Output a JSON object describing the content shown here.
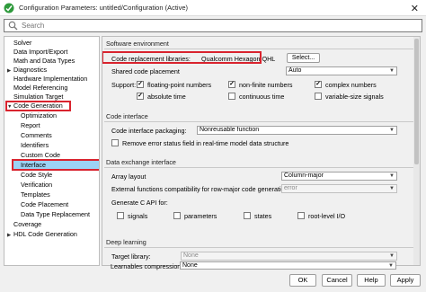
{
  "window": {
    "title": "Configuration Parameters: untitled/Configuration (Active)",
    "close_glyph": "✕"
  },
  "search": {
    "placeholder": "Search"
  },
  "tree": {
    "items": [
      {
        "label": "Solver"
      },
      {
        "label": "Data Import/Export"
      },
      {
        "label": "Math and Data Types"
      },
      {
        "label": "Diagnostics",
        "arrow": "▶"
      },
      {
        "label": "Hardware Implementation"
      },
      {
        "label": "Model Referencing"
      },
      {
        "label": "Simulation Target"
      },
      {
        "label": "Code Generation",
        "arrow": "▼"
      },
      {
        "label": "Optimization"
      },
      {
        "label": "Report"
      },
      {
        "label": "Comments"
      },
      {
        "label": "Identifiers"
      },
      {
        "label": "Custom Code"
      },
      {
        "label": "Interface"
      },
      {
        "label": "Code Style"
      },
      {
        "label": "Verification"
      },
      {
        "label": "Templates"
      },
      {
        "label": "Code Placement"
      },
      {
        "label": "Data Type Replacement"
      },
      {
        "label": "Coverage"
      },
      {
        "label": "HDL Code Generation",
        "arrow": "▶"
      }
    ]
  },
  "software_env": {
    "title": "Software environment",
    "ccr_label": "Code replacement libraries:",
    "ccr_value": "Qualcomm Hexagon QHL",
    "select_button": "Select...",
    "shared_label": "Shared code placement",
    "shared_value": "Auto",
    "support_label": "Support:",
    "options": {
      "floating": "floating-point numbers",
      "nonfinite": "non-finite numbers",
      "complex": "complex numbers",
      "absolute": "absolute time",
      "continuous": "continuous time",
      "variable": "variable-size signals"
    }
  },
  "code_interface": {
    "title": "Code interface",
    "packaging_label": "Code interface packaging:",
    "packaging_value": "Nonreusable function",
    "remove_error_label": "Remove error status field in real-time model data structure"
  },
  "data_exchange": {
    "title": "Data exchange interface",
    "array_label": "Array layout",
    "array_value": "Column-major",
    "external_label": "External functions compatibility for row-major code generation:",
    "external_value": "error",
    "capi_label": "Generate C API for:",
    "capi": {
      "signals": "signals",
      "parameters": "parameters",
      "states": "states",
      "rootlevel": "root-level I/O"
    }
  },
  "deep_learning": {
    "title": "Deep learning",
    "target_label": "Target library:",
    "target_value": "None",
    "learnables_label": "Learnables compression:",
    "learnables_value": "None"
  },
  "footer": {
    "ok": "OK",
    "cancel": "Cancel",
    "help": "Help",
    "apply": "Apply"
  },
  "glyphs": {
    "check": "✓",
    "dropdown": "▼"
  },
  "colors": {
    "highlight": "#d9232e",
    "selection": "#9cd3f5"
  }
}
